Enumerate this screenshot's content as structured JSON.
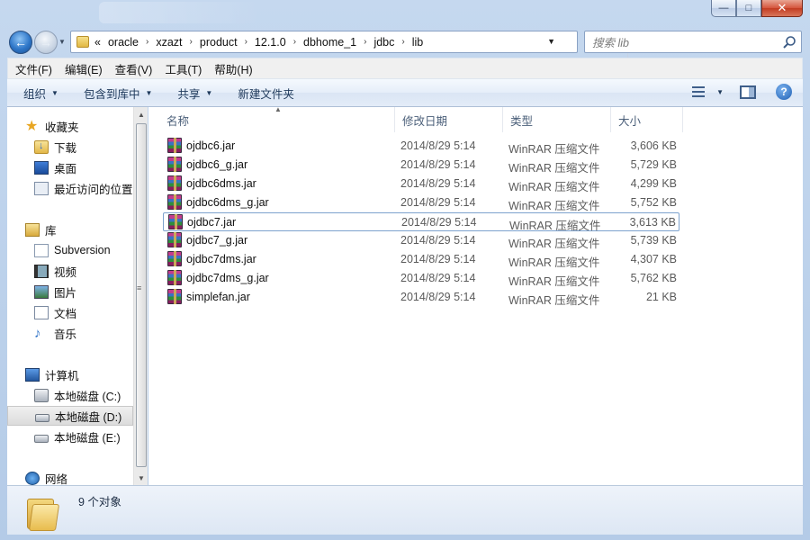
{
  "window": {
    "controls": {
      "minimize": "—",
      "maximize": "□",
      "close": "✕"
    }
  },
  "nav": {
    "back_icon": "arrow-left-icon",
    "forward_icon": "arrow-right-icon"
  },
  "address": {
    "overflow": "«",
    "crumbs": [
      "oracle",
      "xzazt",
      "product",
      "12.1.0",
      "dbhome_1",
      "jdbc",
      "lib"
    ],
    "separator": "›",
    "dropdown": "▼"
  },
  "search": {
    "placeholder": "搜索 lib"
  },
  "menu": [
    "文件(F)",
    "编辑(E)",
    "查看(V)",
    "工具(T)",
    "帮助(H)"
  ],
  "toolbar": {
    "organize": "组织",
    "include_library": "包含到库中",
    "share": "共享",
    "new_folder": "新建文件夹",
    "caret": "▼",
    "help": "?"
  },
  "sidebar": {
    "favorites": {
      "label": "收藏夹",
      "items": [
        "下载",
        "桌面",
        "最近访问的位置"
      ]
    },
    "libraries": {
      "label": "库",
      "items": [
        "Subversion",
        "视频",
        "图片",
        "文档",
        "音乐"
      ]
    },
    "computer": {
      "label": "计算机",
      "items": [
        "本地磁盘 (C:)",
        "本地磁盘 (D:)",
        "本地磁盘 (E:)"
      ]
    },
    "network": {
      "label": "网络"
    },
    "selected": "本地磁盘 (D:)"
  },
  "columns": {
    "name": "名称",
    "date": "修改日期",
    "type": "类型",
    "size": "大小"
  },
  "files": [
    {
      "name": "ojdbc6.jar",
      "date": "2014/8/29 5:14",
      "type": "WinRAR 压缩文件",
      "size": "3,606 KB"
    },
    {
      "name": "ojdbc6_g.jar",
      "date": "2014/8/29 5:14",
      "type": "WinRAR 压缩文件",
      "size": "5,729 KB"
    },
    {
      "name": "ojdbc6dms.jar",
      "date": "2014/8/29 5:14",
      "type": "WinRAR 压缩文件",
      "size": "4,299 KB"
    },
    {
      "name": "ojdbc6dms_g.jar",
      "date": "2014/8/29 5:14",
      "type": "WinRAR 压缩文件",
      "size": "5,752 KB"
    },
    {
      "name": "ojdbc7.jar",
      "date": "2014/8/29 5:14",
      "type": "WinRAR 压缩文件",
      "size": "3,613 KB"
    },
    {
      "name": "ojdbc7_g.jar",
      "date": "2014/8/29 5:14",
      "type": "WinRAR 压缩文件",
      "size": "5,739 KB"
    },
    {
      "name": "ojdbc7dms.jar",
      "date": "2014/8/29 5:14",
      "type": "WinRAR 压缩文件",
      "size": "4,307 KB"
    },
    {
      "name": "ojdbc7dms_g.jar",
      "date": "2014/8/29 5:14",
      "type": "WinRAR 压缩文件",
      "size": "5,762 KB"
    },
    {
      "name": "simplefan.jar",
      "date": "2014/8/29 5:14",
      "type": "WinRAR 压缩文件",
      "size": "21 KB"
    }
  ],
  "focused_file": "ojdbc7.jar",
  "status": {
    "count": "9 个对象"
  }
}
